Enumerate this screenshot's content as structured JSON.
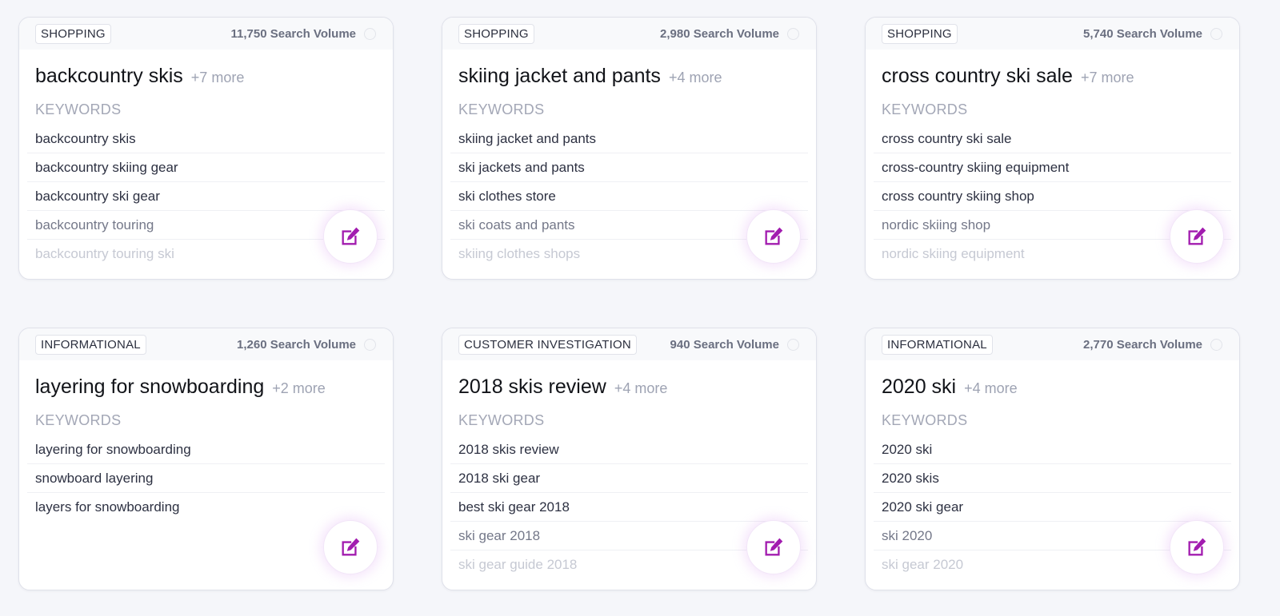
{
  "accent_color": "#a21caf",
  "cards": [
    {
      "badge": "SHOPPING",
      "volume": "11,750 Search Volume",
      "title": "backcountry skis",
      "more": "+7 more",
      "keywords_heading": "KEYWORDS",
      "keywords": [
        "backcountry skis",
        "backcountry skiing gear",
        "backcountry ski gear",
        "backcountry touring",
        "backcountry touring ski"
      ],
      "edit_icon": "edit-icon"
    },
    {
      "badge": "SHOPPING",
      "volume": "2,980 Search Volume",
      "title": "skiing jacket and pants",
      "more": "+4 more",
      "keywords_heading": "KEYWORDS",
      "keywords": [
        "skiing jacket and pants",
        "ski jackets and pants",
        "ski clothes store",
        "ski coats and pants",
        "skiing clothes shops"
      ],
      "edit_icon": "edit-icon"
    },
    {
      "badge": "SHOPPING",
      "volume": "5,740 Search Volume",
      "title": "cross country ski sale",
      "more": "+7 more",
      "keywords_heading": "KEYWORDS",
      "keywords": [
        "cross country ski sale",
        "cross-country skiing equipment",
        "cross country skiing shop",
        "nordic skiing shop",
        "nordic skiing equipment"
      ],
      "edit_icon": "edit-icon"
    },
    {
      "badge": "INFORMATIONAL",
      "volume": "1,260 Search Volume",
      "title": "layering for snowboarding",
      "more": "+2 more",
      "keywords_heading": "KEYWORDS",
      "keywords": [
        "layering for snowboarding",
        "snowboard layering",
        "layers for snowboarding"
      ],
      "edit_icon": "edit-icon"
    },
    {
      "badge": "CUSTOMER INVESTIGATION",
      "volume": "940 Search Volume",
      "title": "2018 skis review",
      "more": "+4 more",
      "keywords_heading": "KEYWORDS",
      "keywords": [
        "2018 skis review",
        "2018 ski gear",
        "best ski gear 2018",
        "ski gear 2018",
        "ski gear guide 2018"
      ],
      "edit_icon": "edit-icon"
    },
    {
      "badge": "INFORMATIONAL",
      "volume": "2,770 Search Volume",
      "title": "2020 ski",
      "more": "+4 more",
      "keywords_heading": "KEYWORDS",
      "keywords": [
        "2020 ski",
        "2020 skis",
        "2020 ski gear",
        "ski 2020",
        "ski gear 2020"
      ],
      "edit_icon": "edit-icon"
    }
  ]
}
